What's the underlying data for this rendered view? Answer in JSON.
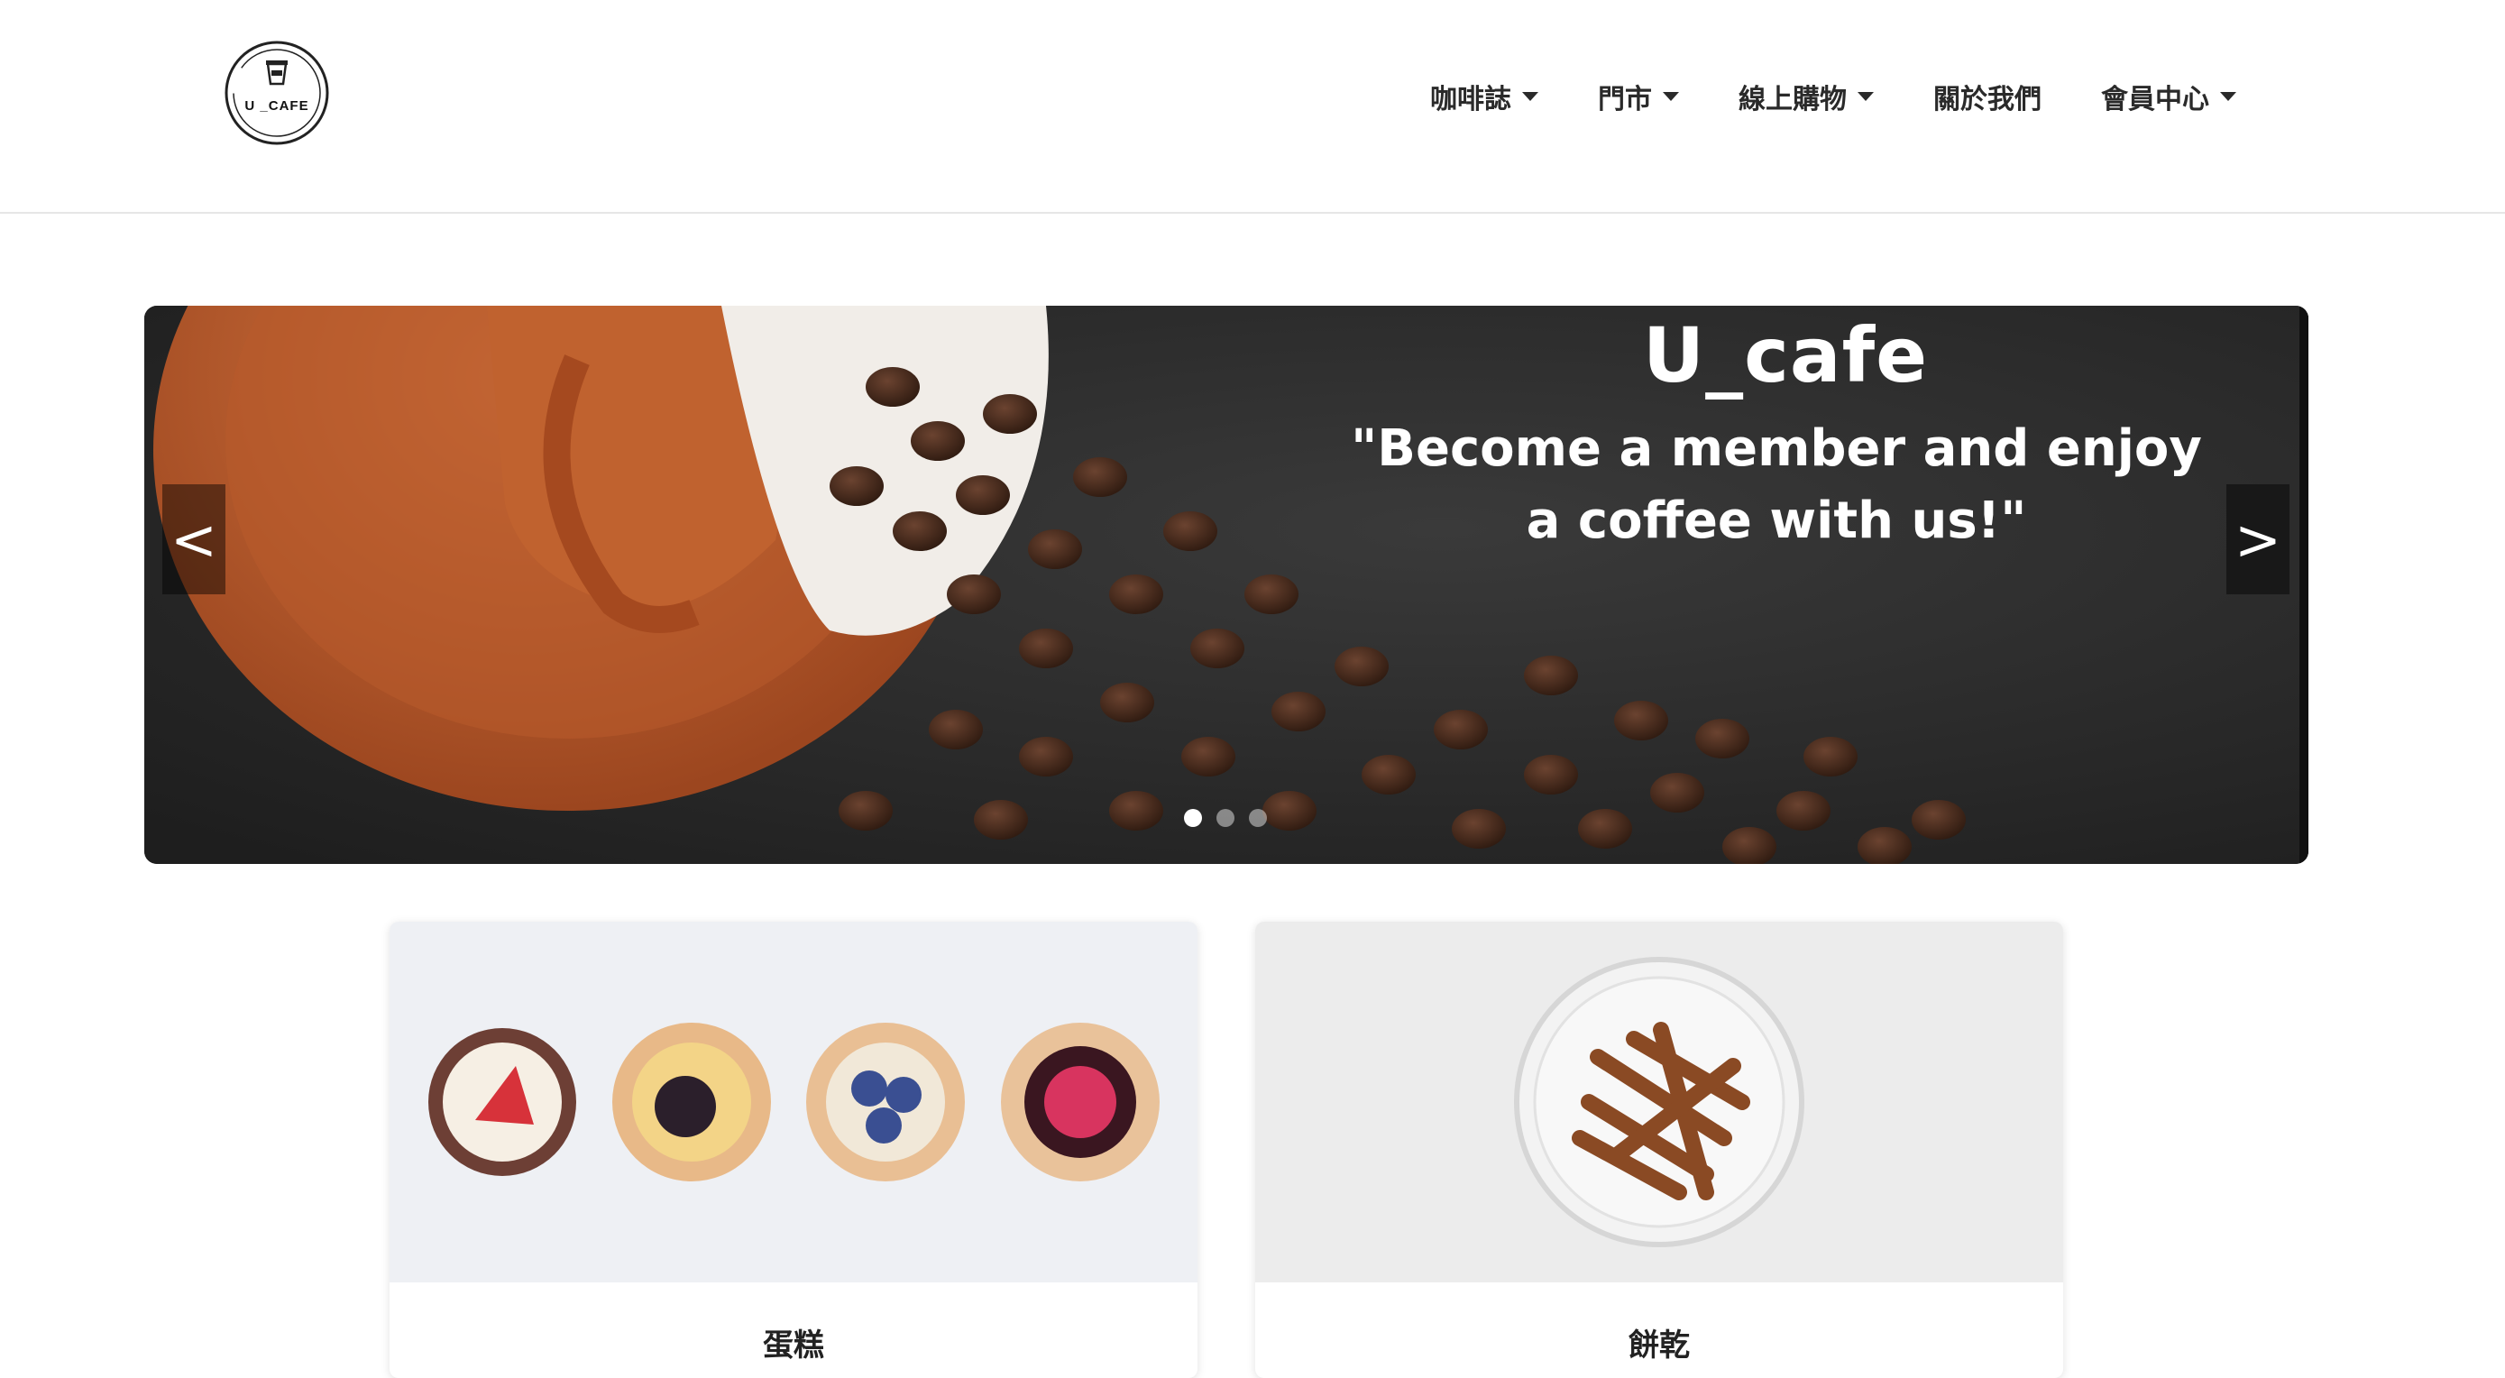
{
  "header": {
    "logo_text": "U _CAFE",
    "nav": [
      {
        "label": "咖啡誌",
        "has_dropdown": true
      },
      {
        "label": "門市",
        "has_dropdown": true
      },
      {
        "label": "線上購物",
        "has_dropdown": true
      },
      {
        "label": "關於我們",
        "has_dropdown": false
      },
      {
        "label": "會員中心",
        "has_dropdown": true
      }
    ]
  },
  "carousel": {
    "title": "U_cafe",
    "quote_line1": "\"Become a member and enjoy",
    "quote_line2": "a coffee with us!\"",
    "prev_label": "<",
    "next_label": ">",
    "slide_count": 3,
    "active_slide": 1
  },
  "cards": [
    {
      "title": "蛋糕",
      "image": "tarts-image"
    },
    {
      "title": "餅乾",
      "image": "cinnamon-jar-image"
    }
  ],
  "colors": {
    "accent_cup": "#b4582b",
    "background": "#ffffff",
    "nav_text": "#2a2a2a"
  }
}
